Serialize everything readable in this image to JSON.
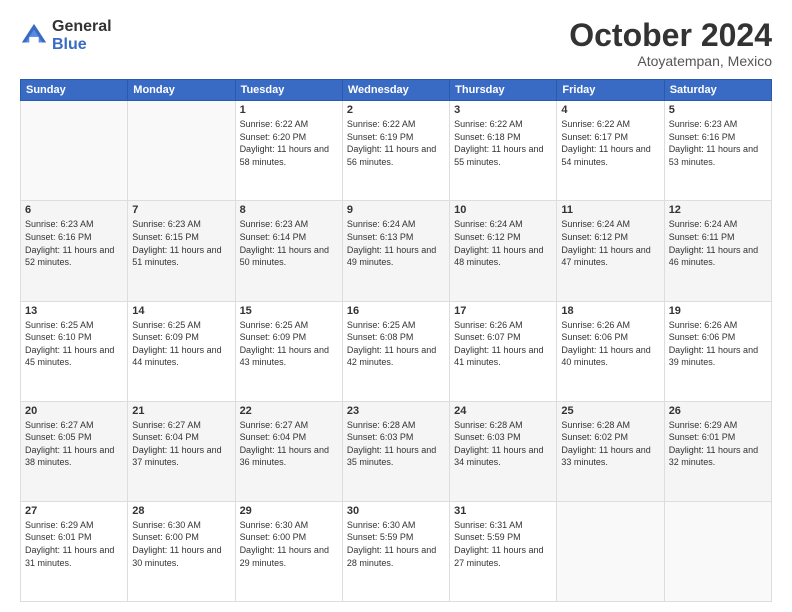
{
  "header": {
    "logo_general": "General",
    "logo_blue": "Blue",
    "month_title": "October 2024",
    "location": "Atoyatempan, Mexico"
  },
  "weekdays": [
    "Sunday",
    "Monday",
    "Tuesday",
    "Wednesday",
    "Thursday",
    "Friday",
    "Saturday"
  ],
  "weeks": [
    [
      {
        "day": "",
        "sunrise": "",
        "sunset": "",
        "daylight": ""
      },
      {
        "day": "",
        "sunrise": "",
        "sunset": "",
        "daylight": ""
      },
      {
        "day": "1",
        "sunrise": "Sunrise: 6:22 AM",
        "sunset": "Sunset: 6:20 PM",
        "daylight": "Daylight: 11 hours and 58 minutes."
      },
      {
        "day": "2",
        "sunrise": "Sunrise: 6:22 AM",
        "sunset": "Sunset: 6:19 PM",
        "daylight": "Daylight: 11 hours and 56 minutes."
      },
      {
        "day": "3",
        "sunrise": "Sunrise: 6:22 AM",
        "sunset": "Sunset: 6:18 PM",
        "daylight": "Daylight: 11 hours and 55 minutes."
      },
      {
        "day": "4",
        "sunrise": "Sunrise: 6:22 AM",
        "sunset": "Sunset: 6:17 PM",
        "daylight": "Daylight: 11 hours and 54 minutes."
      },
      {
        "day": "5",
        "sunrise": "Sunrise: 6:23 AM",
        "sunset": "Sunset: 6:16 PM",
        "daylight": "Daylight: 11 hours and 53 minutes."
      }
    ],
    [
      {
        "day": "6",
        "sunrise": "Sunrise: 6:23 AM",
        "sunset": "Sunset: 6:16 PM",
        "daylight": "Daylight: 11 hours and 52 minutes."
      },
      {
        "day": "7",
        "sunrise": "Sunrise: 6:23 AM",
        "sunset": "Sunset: 6:15 PM",
        "daylight": "Daylight: 11 hours and 51 minutes."
      },
      {
        "day": "8",
        "sunrise": "Sunrise: 6:23 AM",
        "sunset": "Sunset: 6:14 PM",
        "daylight": "Daylight: 11 hours and 50 minutes."
      },
      {
        "day": "9",
        "sunrise": "Sunrise: 6:24 AM",
        "sunset": "Sunset: 6:13 PM",
        "daylight": "Daylight: 11 hours and 49 minutes."
      },
      {
        "day": "10",
        "sunrise": "Sunrise: 6:24 AM",
        "sunset": "Sunset: 6:12 PM",
        "daylight": "Daylight: 11 hours and 48 minutes."
      },
      {
        "day": "11",
        "sunrise": "Sunrise: 6:24 AM",
        "sunset": "Sunset: 6:12 PM",
        "daylight": "Daylight: 11 hours and 47 minutes."
      },
      {
        "day": "12",
        "sunrise": "Sunrise: 6:24 AM",
        "sunset": "Sunset: 6:11 PM",
        "daylight": "Daylight: 11 hours and 46 minutes."
      }
    ],
    [
      {
        "day": "13",
        "sunrise": "Sunrise: 6:25 AM",
        "sunset": "Sunset: 6:10 PM",
        "daylight": "Daylight: 11 hours and 45 minutes."
      },
      {
        "day": "14",
        "sunrise": "Sunrise: 6:25 AM",
        "sunset": "Sunset: 6:09 PM",
        "daylight": "Daylight: 11 hours and 44 minutes."
      },
      {
        "day": "15",
        "sunrise": "Sunrise: 6:25 AM",
        "sunset": "Sunset: 6:09 PM",
        "daylight": "Daylight: 11 hours and 43 minutes."
      },
      {
        "day": "16",
        "sunrise": "Sunrise: 6:25 AM",
        "sunset": "Sunset: 6:08 PM",
        "daylight": "Daylight: 11 hours and 42 minutes."
      },
      {
        "day": "17",
        "sunrise": "Sunrise: 6:26 AM",
        "sunset": "Sunset: 6:07 PM",
        "daylight": "Daylight: 11 hours and 41 minutes."
      },
      {
        "day": "18",
        "sunrise": "Sunrise: 6:26 AM",
        "sunset": "Sunset: 6:06 PM",
        "daylight": "Daylight: 11 hours and 40 minutes."
      },
      {
        "day": "19",
        "sunrise": "Sunrise: 6:26 AM",
        "sunset": "Sunset: 6:06 PM",
        "daylight": "Daylight: 11 hours and 39 minutes."
      }
    ],
    [
      {
        "day": "20",
        "sunrise": "Sunrise: 6:27 AM",
        "sunset": "Sunset: 6:05 PM",
        "daylight": "Daylight: 11 hours and 38 minutes."
      },
      {
        "day": "21",
        "sunrise": "Sunrise: 6:27 AM",
        "sunset": "Sunset: 6:04 PM",
        "daylight": "Daylight: 11 hours and 37 minutes."
      },
      {
        "day": "22",
        "sunrise": "Sunrise: 6:27 AM",
        "sunset": "Sunset: 6:04 PM",
        "daylight": "Daylight: 11 hours and 36 minutes."
      },
      {
        "day": "23",
        "sunrise": "Sunrise: 6:28 AM",
        "sunset": "Sunset: 6:03 PM",
        "daylight": "Daylight: 11 hours and 35 minutes."
      },
      {
        "day": "24",
        "sunrise": "Sunrise: 6:28 AM",
        "sunset": "Sunset: 6:03 PM",
        "daylight": "Daylight: 11 hours and 34 minutes."
      },
      {
        "day": "25",
        "sunrise": "Sunrise: 6:28 AM",
        "sunset": "Sunset: 6:02 PM",
        "daylight": "Daylight: 11 hours and 33 minutes."
      },
      {
        "day": "26",
        "sunrise": "Sunrise: 6:29 AM",
        "sunset": "Sunset: 6:01 PM",
        "daylight": "Daylight: 11 hours and 32 minutes."
      }
    ],
    [
      {
        "day": "27",
        "sunrise": "Sunrise: 6:29 AM",
        "sunset": "Sunset: 6:01 PM",
        "daylight": "Daylight: 11 hours and 31 minutes."
      },
      {
        "day": "28",
        "sunrise": "Sunrise: 6:30 AM",
        "sunset": "Sunset: 6:00 PM",
        "daylight": "Daylight: 11 hours and 30 minutes."
      },
      {
        "day": "29",
        "sunrise": "Sunrise: 6:30 AM",
        "sunset": "Sunset: 6:00 PM",
        "daylight": "Daylight: 11 hours and 29 minutes."
      },
      {
        "day": "30",
        "sunrise": "Sunrise: 6:30 AM",
        "sunset": "Sunset: 5:59 PM",
        "daylight": "Daylight: 11 hours and 28 minutes."
      },
      {
        "day": "31",
        "sunrise": "Sunrise: 6:31 AM",
        "sunset": "Sunset: 5:59 PM",
        "daylight": "Daylight: 11 hours and 27 minutes."
      },
      {
        "day": "",
        "sunrise": "",
        "sunset": "",
        "daylight": ""
      },
      {
        "day": "",
        "sunrise": "",
        "sunset": "",
        "daylight": ""
      }
    ]
  ]
}
